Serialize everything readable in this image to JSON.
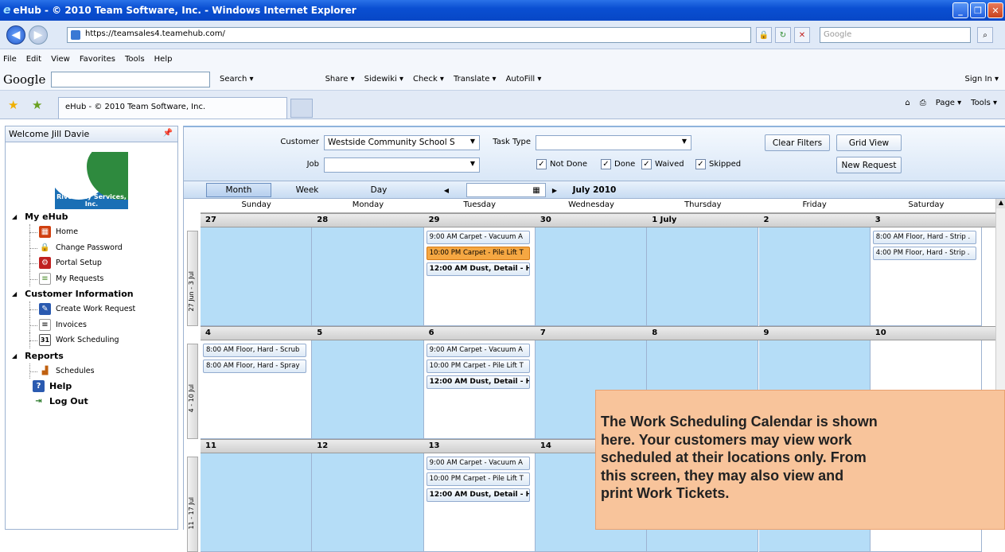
{
  "window": {
    "title": "eHub - © 2010 Team Software, Inc. - Windows Internet Explorer",
    "buttons": [
      "_",
      "❐",
      "✕"
    ]
  },
  "address": {
    "url": "https://teamsales4.teamehub.com/",
    "search_placeholder": "Google"
  },
  "menu": [
    "File",
    "Edit",
    "View",
    "Favorites",
    "Tools",
    "Help"
  ],
  "google_toolbar": {
    "logo": "Google",
    "items": [
      "Search ▾",
      "Share ▾",
      "Sidewiki ▾",
      "Check ▾",
      "Translate ▾",
      "AutoFill ▾"
    ],
    "signin": "Sign In ▾"
  },
  "tabs": {
    "active": "eHub - © 2010 Team Software, Inc.",
    "commands": [
      "Page ▾",
      "Tools ▾"
    ]
  },
  "sidebar": {
    "welcome": "Welcome Jill Davie",
    "logo_text": "River City Services, Inc.",
    "sections": [
      {
        "label": "My eHub",
        "items": [
          "Home",
          "Change Password",
          "Portal Setup",
          "My Requests"
        ]
      },
      {
        "label": "Customer Information",
        "items": [
          "Create Work Request",
          "Invoices",
          "Work Scheduling"
        ]
      },
      {
        "label": "Reports",
        "items": [
          "Schedules"
        ]
      }
    ],
    "help": "Help",
    "logout": "Log Out"
  },
  "filters": {
    "customer_label": "Customer",
    "customer_value": "Westside Community School S",
    "job_label": "Job",
    "job_value": "",
    "task_type_label": "Task Type",
    "task_type_value": "",
    "checks": [
      {
        "label": "Not Done",
        "checked": true
      },
      {
        "label": "Done",
        "checked": true
      },
      {
        "label": "Waived",
        "checked": true
      },
      {
        "label": "Skipped",
        "checked": true
      }
    ],
    "clear_filters": "Clear Filters",
    "grid_view": "Grid View",
    "new_request": "New Request"
  },
  "view": {
    "month": "Month",
    "week": "Week",
    "day": "Day",
    "current": "July 2010"
  },
  "calendar": {
    "days": [
      "Sunday",
      "Monday",
      "Tuesday",
      "Wednesday",
      "Thursday",
      "Friday",
      "Saturday"
    ],
    "weeks": [
      {
        "label": "27 Jun - 3 Jul",
        "dates": [
          "27",
          "28",
          "29",
          "30",
          "1 July",
          "2",
          "3"
        ],
        "appointments": [
          [],
          [],
          [
            {
              "text": "9:00 AM Carpet - Vacuum A",
              "style": "normal"
            },
            {
              "text": "10:00 PM Carpet - Pile Lift T",
              "style": "orange"
            },
            {
              "text": "12:00 AM Dust, Detail - H",
              "style": "bold"
            }
          ],
          [],
          [],
          [],
          [
            {
              "text": "8:00 AM Floor, Hard - Strip .",
              "style": "normal"
            },
            {
              "text": "4:00 PM Floor, Hard - Strip .",
              "style": "normal"
            }
          ]
        ]
      },
      {
        "label": "4 - 10 Jul",
        "dates": [
          "4",
          "5",
          "6",
          "7",
          "8",
          "9",
          "10"
        ],
        "appointments": [
          [
            {
              "text": "8:00 AM Floor, Hard - Scrub",
              "style": "normal"
            },
            {
              "text": "8:00 AM Floor, Hard - Spray",
              "style": "normal"
            }
          ],
          [],
          [
            {
              "text": "9:00 AM Carpet - Vacuum A",
              "style": "normal"
            },
            {
              "text": "10:00 PM Carpet - Pile Lift T",
              "style": "normal"
            },
            {
              "text": "12:00 AM Dust, Detail - H",
              "style": "bold"
            }
          ],
          [],
          [],
          [],
          []
        ]
      },
      {
        "label": "11 - 17 Jul",
        "dates": [
          "11",
          "12",
          "13",
          "14",
          "15",
          "16",
          "17"
        ],
        "appointments": [
          [],
          [],
          [
            {
              "text": "9:00 AM Carpet - Vacuum A",
              "style": "normal"
            },
            {
              "text": "10:00 PM Carpet - Pile Lift T",
              "style": "normal"
            },
            {
              "text": "12:00 AM Dust, Detail - H",
              "style": "bold"
            }
          ],
          [],
          [],
          [],
          []
        ]
      }
    ]
  },
  "callout": {
    "lines": [
      "The Work Scheduling Calendar is shown",
      "here.  Your customers may view work",
      "scheduled at their locations only.  From",
      "this screen, they may also view and",
      "print Work Tickets."
    ]
  }
}
